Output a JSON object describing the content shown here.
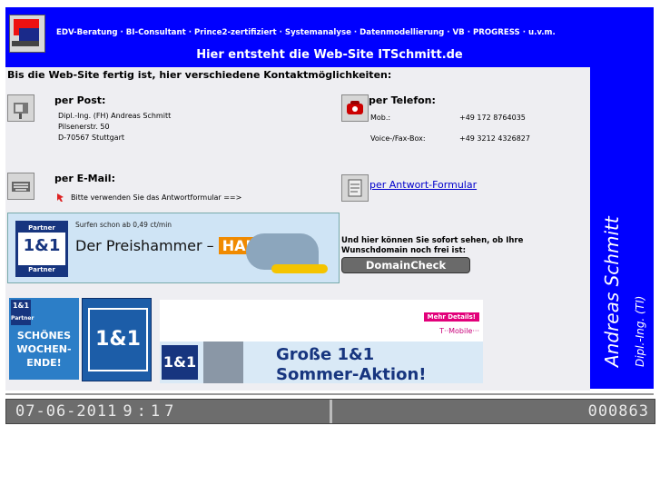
{
  "header": {
    "services": "EDV-Beratung · BI-Consultant · Prince2-zertifiziert · Systemanalyse · Datenmodellierung · VB · PROGRESS · u.v.m.",
    "title": "Hier entsteht die Web-Site ITSchmitt.de"
  },
  "sidebar": {
    "name": "Andreas Schmitt",
    "title": "Dipl.-Ing. (TI)"
  },
  "intro": "Bis die Web-Site fertig ist, hier verschiedene Kontaktmöglichkeiten:",
  "post": {
    "title": "per Post:",
    "line1": "Dipl.-Ing. (FH) Andreas Schmitt",
    "line2": "Pilsenerstr. 50",
    "line3": "D-70567 Stuttgart"
  },
  "telefon": {
    "title": "per Telefon:",
    "mob_label": "Mob.:",
    "mob_value": "+49 172 8764035",
    "fax_label": "Voice-/Fax-Box:",
    "fax_value": "+49 3212 4326827"
  },
  "email": {
    "title": "per E-Mail:",
    "text": "Bitte verwenden Sie das Antwortformular ==>"
  },
  "formular": {
    "link": "per Antwort-Formular"
  },
  "ads": {
    "hai_badge_top": "Partner",
    "hai_badge_mid": "1&1",
    "hai_badge_bot": "Partner",
    "hai_sub": "Surfen schon ab 0,49 ct/min",
    "hai_main": "Der Preishammer –",
    "hai_word": "HAI",
    "domain_text1": "Und hier können Sie sofort sehen, ob Ihre",
    "domain_text2": "Wunschdomain noch frei ist:",
    "domain_btn_a": "Domain",
    "domain_btn_b": "Check",
    "woe_badge1": "1&1",
    "woe_badge2": "Partner",
    "woe_line1": "SCHÖNES",
    "woe_line2": "WOCHEN-",
    "woe_line3": "ENDE!",
    "brand": "1&1",
    "sommer_details": "Mehr Details!",
    "sommer_tmobile": "T··Mobile···",
    "sommer_logo": "1&1",
    "sommer_line1": "Große 1&1",
    "sommer_line2": "Sommer-Aktion!"
  },
  "status": {
    "date": "07-06-2011",
    "time": "9:17",
    "counter": "000863"
  }
}
